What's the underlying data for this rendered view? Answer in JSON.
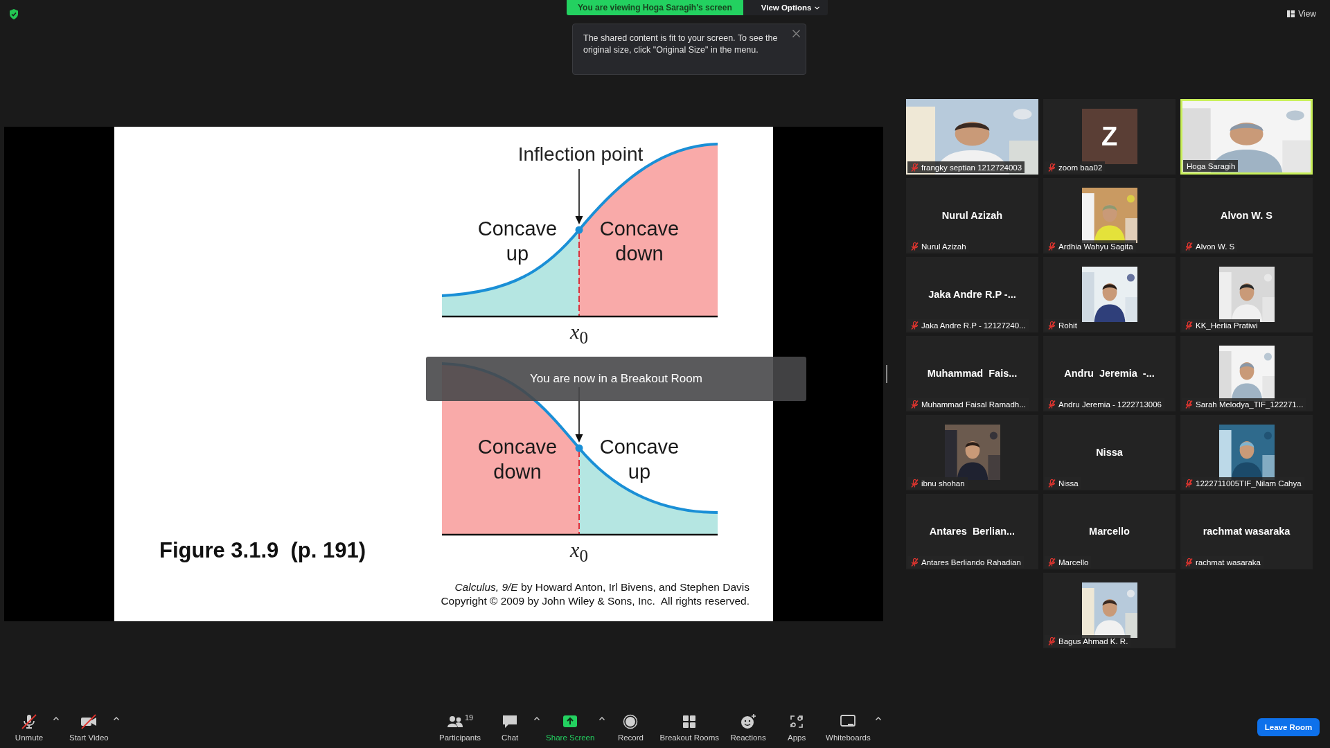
{
  "top_bar": {
    "sharing_notice": "You are viewing Hoga Saragih's screen",
    "view_options": "View Options",
    "tooltip": "The shared content is fit to your screen. To see the original size, click \"Original Size\" in the menu.",
    "view_button": "View"
  },
  "slide": {
    "figure_caption": "Figure 3.1.9  (p. 191)",
    "graphs": [
      {
        "kind": "rising",
        "title": "Inflection point",
        "left_label": "Concave up",
        "right_label": "Concave down",
        "axis_label": "*x*$_{0}$"
      },
      {
        "kind": "falling",
        "left_label": "Concave down",
        "right_label": "Concave up",
        "axis_label": "*x*$_{0}$"
      }
    ],
    "citation": [
      "*Calculus, 9/E* by Howard Anton, Irl Bivens, and Stephen Davis",
      "Copyright © 2009 by John Wiley & Sons, Inc.  All rights reserved."
    ]
  },
  "notification": "You are now in a Breakout Room",
  "tiles": [
    {
      "kind": "video",
      "name": "frangky septian 1212724003",
      "muted": true,
      "speaking": false
    },
    {
      "kind": "letter",
      "initial": "Z",
      "name": "zoom baa02",
      "muted": true,
      "speaking": false
    },
    {
      "kind": "video",
      "name": "Hoga Saragih",
      "muted": false,
      "speaking": true
    },
    {
      "kind": "name",
      "display": "Nurul Azizah",
      "name": "Nurul Azizah",
      "muted": true,
      "speaking": false
    },
    {
      "kind": "avatar",
      "name": "Ardhia Wahyu Sagita",
      "muted": true,
      "speaking": false
    },
    {
      "kind": "name",
      "display": "Alvon W. S",
      "name": "Alvon W. S",
      "muted": true,
      "speaking": false
    },
    {
      "kind": "name",
      "display": "Jaka Andre R.P -...",
      "name": "Jaka Andre R.P - 12127240...",
      "muted": true,
      "speaking": false
    },
    {
      "kind": "avatar",
      "name": "Rohit",
      "muted": true,
      "speaking": false
    },
    {
      "kind": "avatar",
      "name": "KK_Herlia Pratiwi",
      "muted": true,
      "speaking": false
    },
    {
      "kind": "name",
      "display": "Muhammad  Fais...",
      "name": "Muhammad Faisal Ramadh...",
      "muted": true,
      "speaking": false
    },
    {
      "kind": "name",
      "display": "Andru  Jeremia  -...",
      "name": "Andru Jeremia - 1222713006",
      "muted": true,
      "speaking": false
    },
    {
      "kind": "avatar",
      "name": "Sarah Melodya_TIF_122271...",
      "muted": true,
      "speaking": false
    },
    {
      "kind": "avatar",
      "name": "ibnu shohan",
      "muted": true,
      "speaking": false
    },
    {
      "kind": "name",
      "display": "Nissa",
      "name": "Nissa",
      "muted": true,
      "speaking": false
    },
    {
      "kind": "avatar",
      "name": "1222711005TIF_Nilam Cahya",
      "muted": true,
      "speaking": false
    },
    {
      "kind": "name",
      "display": "Antares  Berlian...",
      "name": "Antares Berliando Rahadian",
      "muted": true,
      "speaking": false
    },
    {
      "kind": "name",
      "display": "Marcello",
      "name": "Marcello",
      "muted": true,
      "speaking": false
    },
    {
      "kind": "name",
      "display": "rachmat wasaraka",
      "name": "rachmat wasaraka",
      "muted": true,
      "speaking": false
    },
    {
      "kind": "avatar",
      "name": "Bagus Ahmad K. R.",
      "muted": true,
      "speaking": false
    }
  ],
  "toolbar": [
    {
      "kind": "mic",
      "label": "Unmute",
      "off": true,
      "caret": true
    },
    {
      "kind": "camera",
      "label": "Start Video",
      "off": true,
      "caret": true
    },
    {
      "kind": "participants",
      "label": "Participants",
      "count": "19",
      "off": false,
      "caret": false
    },
    {
      "kind": "chat",
      "label": "Chat",
      "off": false,
      "caret": true
    },
    {
      "kind": "share",
      "label": "Share Screen",
      "off": false,
      "caret": true
    },
    {
      "kind": "record",
      "label": "Record",
      "off": false,
      "caret": false
    },
    {
      "kind": "breakout",
      "label": "Breakout Rooms",
      "off": false,
      "caret": false
    },
    {
      "kind": "reactions",
      "label": "Reactions",
      "off": false,
      "caret": false
    },
    {
      "kind": "apps",
      "label": "Apps",
      "off": false,
      "caret": false
    },
    {
      "kind": "whiteboard",
      "label": "Whiteboards",
      "off": false,
      "caret": true
    }
  ],
  "leave_button": "Leave Room"
}
